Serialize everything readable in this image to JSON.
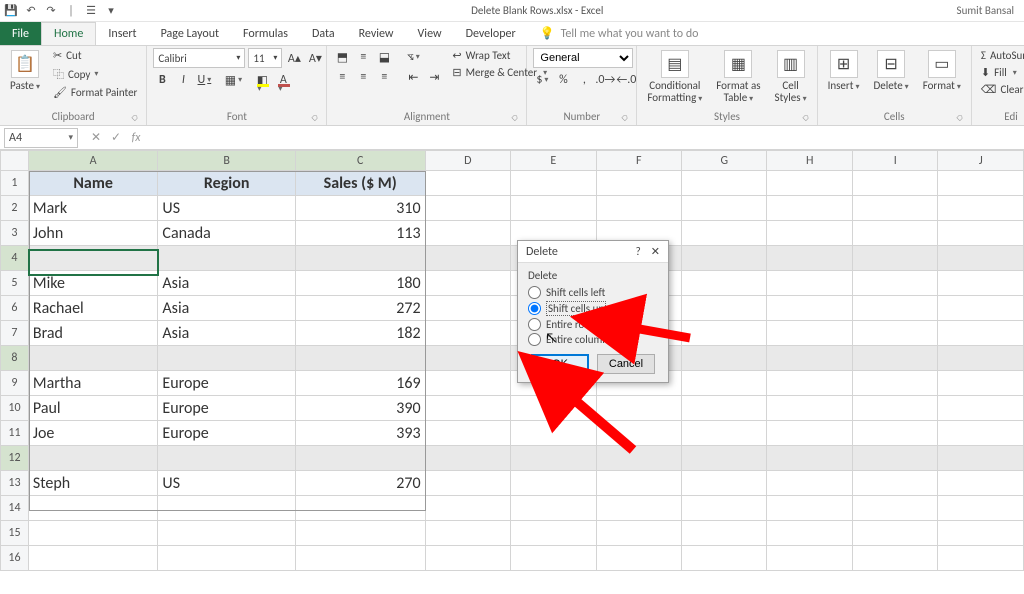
{
  "titlebar": {
    "filename": "Delete Blank Rows.xlsx - Excel",
    "user": "Sumit Bansal"
  },
  "tabs": {
    "file": "File",
    "home": "Home",
    "insert": "Insert",
    "page_layout": "Page Layout",
    "formulas": "Formulas",
    "data": "Data",
    "review": "Review",
    "view": "View",
    "developer": "Developer",
    "tell_me": "Tell me what you want to do"
  },
  "ribbon": {
    "clipboard": {
      "paste": "Paste",
      "cut": "Cut",
      "copy": "Copy",
      "format_painter": "Format Painter",
      "label": "Clipboard"
    },
    "font": {
      "name": "Calibri",
      "size": "11",
      "label": "Font"
    },
    "alignment": {
      "wrap": "Wrap Text",
      "merge": "Merge & Center",
      "label": "Alignment"
    },
    "number": {
      "format": "General",
      "label": "Number"
    },
    "styles": {
      "cf": "Conditional\nFormatting",
      "fat": "Format as\nTable",
      "cs": "Cell\nStyles",
      "label": "Styles"
    },
    "cells": {
      "insert": "Insert",
      "delete": "Delete",
      "format": "Format",
      "label": "Cells"
    },
    "editing": {
      "autosum": "AutoSum",
      "fill": "Fill",
      "clear": "Clear",
      "label": "Edi"
    }
  },
  "namebox": "A4",
  "sheet": {
    "columns": [
      "A",
      "B",
      "C",
      "D",
      "E",
      "F",
      "G",
      "H",
      "I",
      "J"
    ],
    "headers": {
      "name": "Name",
      "region": "Region",
      "sales": "Sales ($ M)"
    },
    "rows": [
      {
        "r": 1,
        "name": "Name",
        "region": "Region",
        "sales": "Sales ($ M)",
        "header": true
      },
      {
        "r": 2,
        "name": "Mark",
        "region": "US",
        "sales": 310
      },
      {
        "r": 3,
        "name": "John",
        "region": "Canada",
        "sales": 113
      },
      {
        "r": 4,
        "blank": true
      },
      {
        "r": 5,
        "name": "Mike",
        "region": "Asia",
        "sales": 180
      },
      {
        "r": 6,
        "name": "Rachael",
        "region": "Asia",
        "sales": 272
      },
      {
        "r": 7,
        "name": "Brad",
        "region": "Asia",
        "sales": 182
      },
      {
        "r": 8,
        "blank": true
      },
      {
        "r": 9,
        "name": "Martha",
        "region": "Europe",
        "sales": 169
      },
      {
        "r": 10,
        "name": "Paul",
        "region": "Europe",
        "sales": 390
      },
      {
        "r": 11,
        "name": "Joe",
        "region": "Europe",
        "sales": 393
      },
      {
        "r": 12,
        "blank": true
      },
      {
        "r": 13,
        "name": "Steph",
        "region": "US",
        "sales": 270
      },
      {
        "r": 14
      },
      {
        "r": 15
      },
      {
        "r": 16
      }
    ]
  },
  "dialog": {
    "title": "Delete",
    "group": "Delete",
    "opt_left": "Shift cells left",
    "opt_up": "Shift cells up",
    "opt_row": "Entire row",
    "opt_col": "Entire column",
    "ok": "OK",
    "cancel": "Cancel"
  },
  "chart_data": {
    "type": "table",
    "columns": [
      "Name",
      "Region",
      "Sales ($ M)"
    ],
    "rows": [
      [
        "Mark",
        "US",
        310
      ],
      [
        "John",
        "Canada",
        113
      ],
      [
        "Mike",
        "Asia",
        180
      ],
      [
        "Rachael",
        "Asia",
        272
      ],
      [
        "Brad",
        "Asia",
        182
      ],
      [
        "Martha",
        "Europe",
        169
      ],
      [
        "Paul",
        "Europe",
        390
      ],
      [
        "Joe",
        "Europe",
        393
      ],
      [
        "Steph",
        "US",
        270
      ]
    ]
  }
}
